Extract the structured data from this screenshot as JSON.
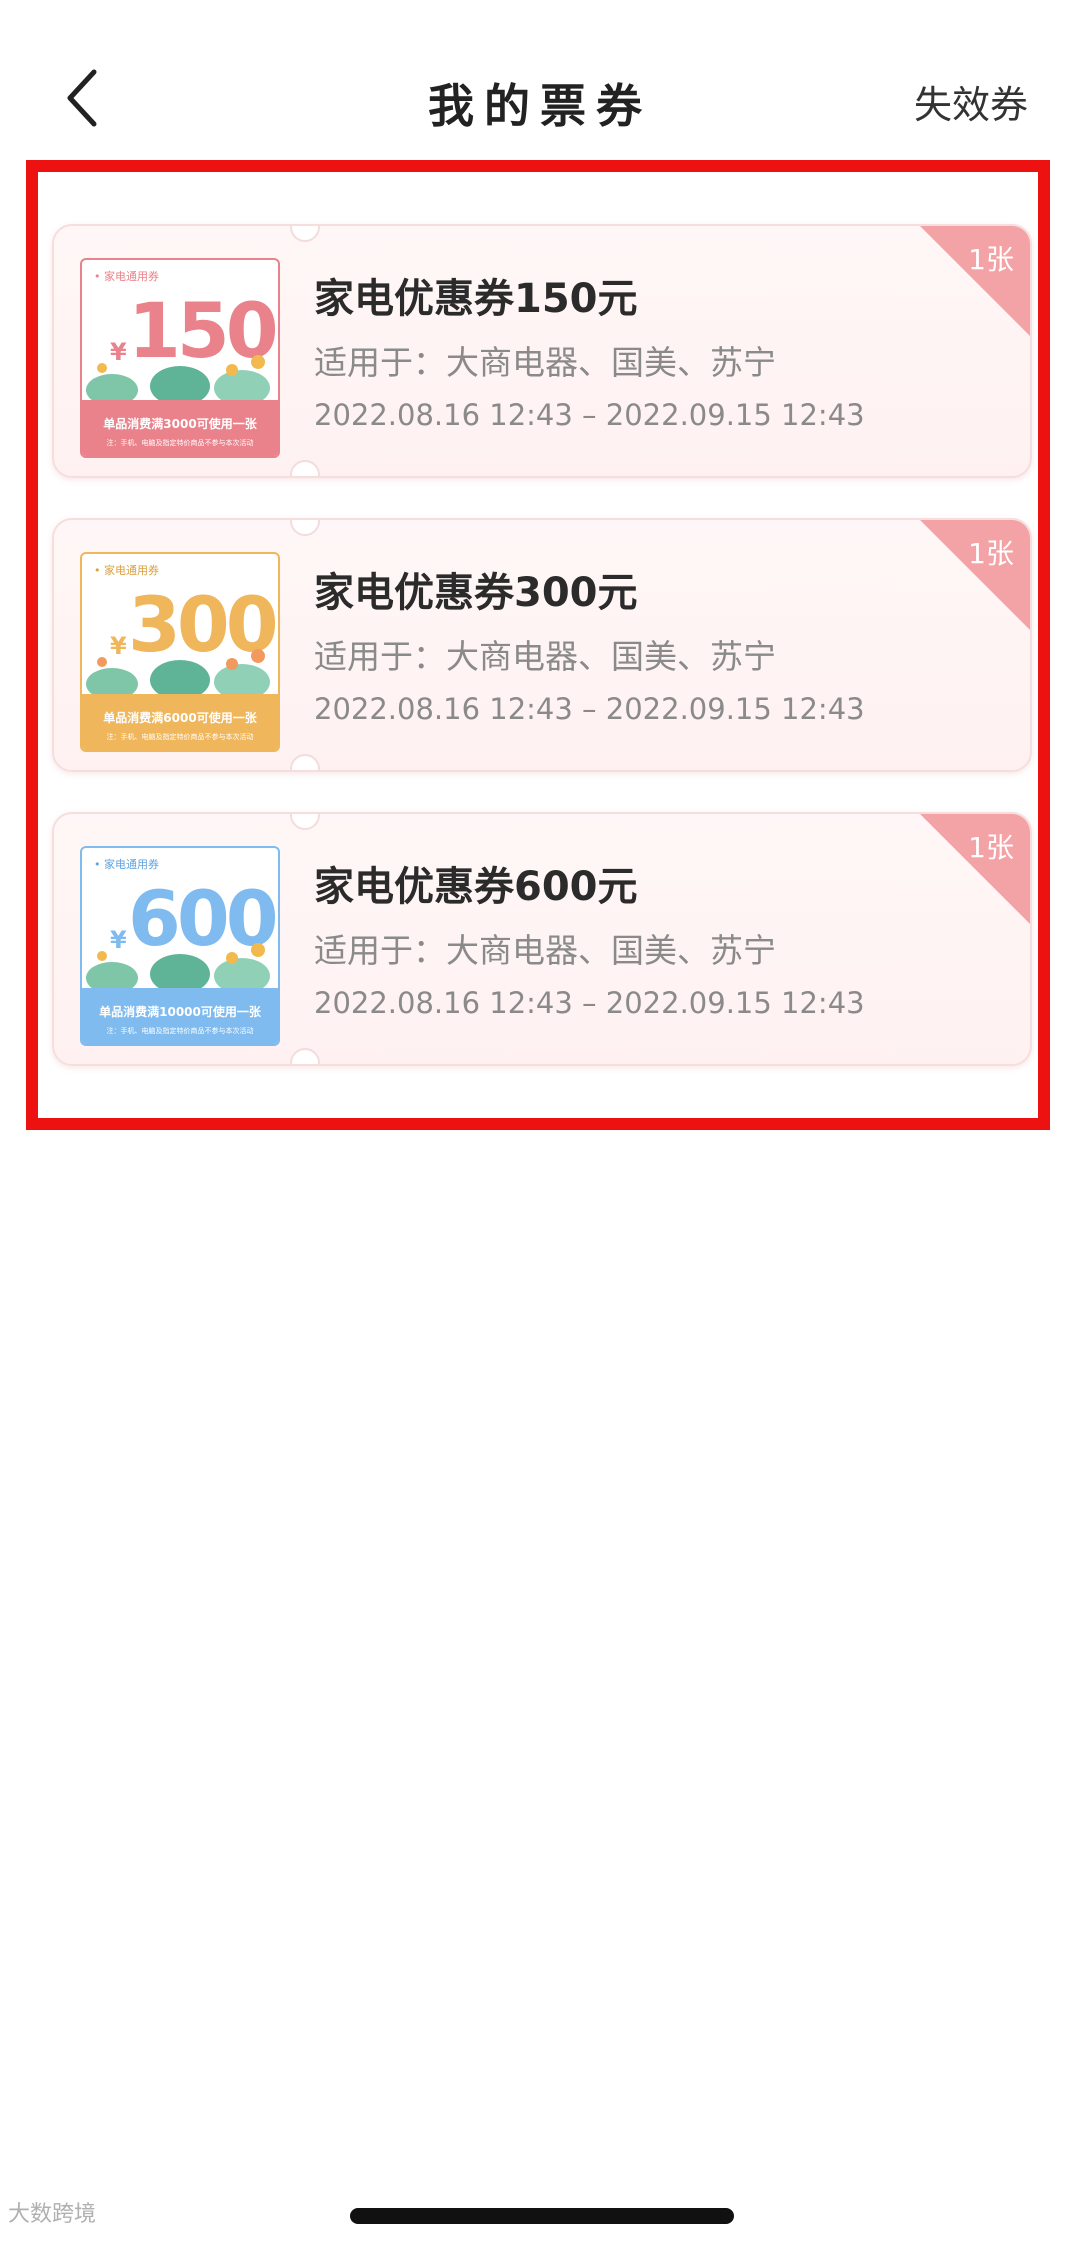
{
  "header": {
    "title": "我的票券",
    "expired_label": "失效券"
  },
  "coupons": [
    {
      "title": "家电优惠券150元",
      "scope": "适用于：大商电器、国美、苏宁",
      "validity": "2022.08.16 12:43 – 2022.09.15 12:43",
      "count": "1张",
      "thumb": {
        "label": "• 家电通用券",
        "amount": "150",
        "currency": "¥",
        "condition": "单品消费满3000可使用一张",
        "note": "注：手机、电脑及指定特价商品不参与本次活动",
        "color": "#e9828a"
      }
    },
    {
      "title": "家电优惠券300元",
      "scope": "适用于：大商电器、国美、苏宁",
      "validity": "2022.08.16 12:43 – 2022.09.15 12:43",
      "count": "1张",
      "thumb": {
        "label": "• 家电通用券",
        "amount": "300",
        "currency": "¥",
        "condition": "单品消费满6000可使用一张",
        "note": "注：手机、电脑及指定特价商品不参与本次活动",
        "color": "#efb65c"
      }
    },
    {
      "title": "家电优惠券600元",
      "scope": "适用于：大商电器、国美、苏宁",
      "validity": "2022.08.16 12:43 – 2022.09.15 12:43",
      "count": "1张",
      "thumb": {
        "label": "• 家电通用券",
        "amount": "600",
        "currency": "¥",
        "condition": "单品消费满10000可使用一张",
        "note": "注：手机、电脑及指定特价商品不参与本次活动",
        "color": "#7fbbef"
      }
    }
  ],
  "watermark": "大数跨境",
  "colors": {
    "highlight_frame": "#ee1111",
    "badge": "#f3a3a6",
    "card_bg": "#fff4f4"
  }
}
